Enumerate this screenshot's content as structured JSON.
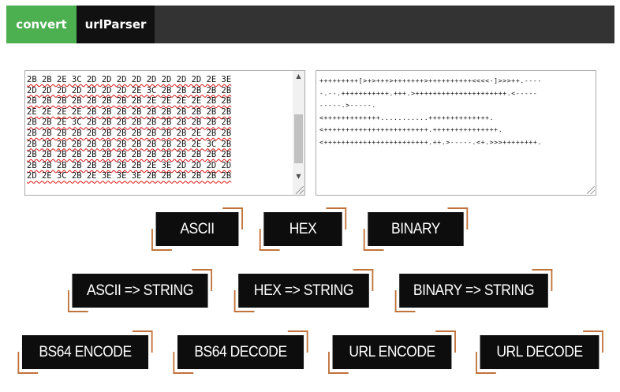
{
  "tabs": {
    "convert": "convert",
    "urlparser": "urlParser"
  },
  "hex_lines": [
    "2B 2B 2E 3C 2D 2D 2D 2D 2D 2D 2D 2D 2E 3E",
    "2D 2D 2D 2D 2D 2D 2D 2E 3C 2B 2B 2B 2B 2B",
    "2B 2B 2B 2B 2B 2B 2B 2B 2E 2E 2E 2E 2B 2B",
    "2E 2E 2E 2E 2B 2B 2B 2B 2B 2B 2B 2B 2B 2B",
    "2B 2B 2E 3C 2B 2B 2B 2B 2B 2B 2B 2B 2B 2B",
    "2B 2B 2B 2B 2B 2B 2B 2B 2B 2B 2B 2E 2B 2B",
    "2B 2B 2B 2B 2B 2B 2B 2B 2B 2B 2B 2E 3C 2B",
    "2B 2B 2B 2B 2B 2B 2B 2B 2B 2B 2B 2B 2B 2B",
    "2B 2B 2B 2B 2B 2B 2B 2B 2E 3E 2D 2D 2D 2D",
    "2D 2E 3C 2B 2E 3E 3E 3E 2B 2B 2B 2B 2B 2B"
  ],
  "brainfuck_text": "+++++++++[>+>+++>+++++++>++++++++++<<<<-]>>>++.----\n-.--.+++++++++++.+++.>+++++++++++++++++++++.<-----\n-----.>-----.\n<+++++++++++++...........++++++++++++++.\n<++++++++++++++++++++++++.+++++++++++++++.\n<++++++++++++++++++++++++.++.>-----.<+.>>>++++++++.",
  "buttons": {
    "ascii": "ASCII",
    "hex": "HEX",
    "binary": "BINARY",
    "ascii_to_string": "ASCII => STRING",
    "hex_to_string": "HEX => STRING",
    "binary_to_string": "BINARY => STRING",
    "bs64_encode": "BS64 ENCODE",
    "bs64_decode": "BS64 DECODE",
    "url_encode": "URL ENCODE",
    "url_decode": "URL DECODE"
  },
  "colors": {
    "tab_active": "#4caf50",
    "tab_dark": "#111111",
    "tabbar": "#333333",
    "button_bg": "#0d0d0d",
    "corner_accent": "#c0733a"
  }
}
